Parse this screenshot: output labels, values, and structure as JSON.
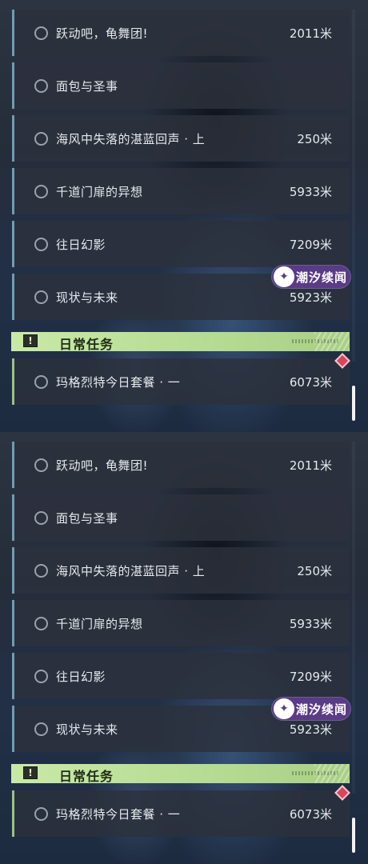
{
  "quests": [
    {
      "name": "跃动吧，龟舞团!",
      "distance": "2011米"
    },
    {
      "name": "面包与圣事",
      "distance": ""
    },
    {
      "name": "海风中失落的湛蓝回声 · 上",
      "distance": "250米"
    },
    {
      "name": "千道门扉的异想",
      "distance": "5933米"
    },
    {
      "name": "往日幻影",
      "distance": "7209米"
    },
    {
      "name": "现状与未来",
      "distance": "5923米"
    }
  ],
  "daily_section": {
    "title": "日常任务",
    "icon": "exclamation-icon",
    "quests": [
      {
        "name": "玛格烈特今日套餐 · 一",
        "distance": "6073米"
      }
    ]
  },
  "watermark": {
    "text": "潮汐续闻",
    "logo": "stylized-star-icon"
  },
  "colors": {
    "quest_accent": "#6f9cb4",
    "daily_accent": "#9bc282",
    "daily_header": "#c9e9a6",
    "tracked_marker": "#d8465e",
    "watermark_bg": "#5a3b86"
  }
}
